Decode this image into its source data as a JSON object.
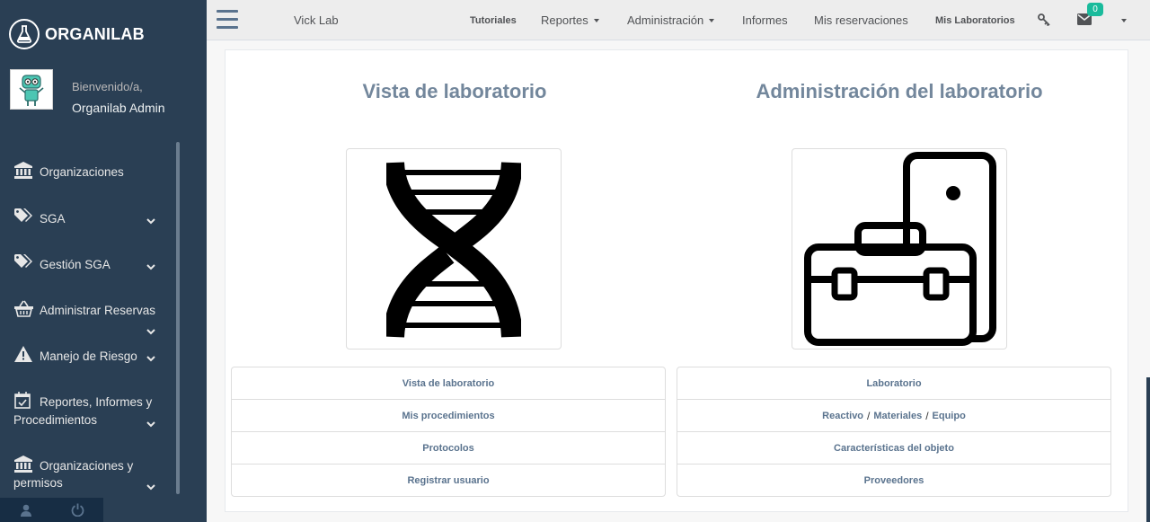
{
  "brand": {
    "name": "ORGANILAB",
    "icon": "flask-icon"
  },
  "profile": {
    "welcome": "Bienvenido/a,",
    "name": "Organilab Admin"
  },
  "sidebar": {
    "items": [
      {
        "label": "Organizaciones",
        "icon": "bank-icon",
        "has_submenu": false
      },
      {
        "label": "SGA",
        "icon": "tags-icon",
        "has_submenu": true
      },
      {
        "label": "Gestión SGA",
        "icon": "tags-icon",
        "has_submenu": true
      },
      {
        "label": "Administrar Reservas",
        "icon": "basket-icon",
        "has_submenu": true
      },
      {
        "label": "Manejo de Riesgo",
        "icon": "warning-icon",
        "has_submenu": true
      },
      {
        "label_line1": "Reportes, Informes y",
        "label_line2": "Procedimientos",
        "icon": "calendar-check-icon",
        "has_submenu": true
      },
      {
        "label_line1": "Organizaciones y",
        "label_line2": "permisos",
        "icon": "bank-icon",
        "has_submenu": true
      }
    ],
    "footer": [
      {
        "icon": "user-icon"
      },
      {
        "icon": "power-icon"
      }
    ]
  },
  "topnav": {
    "lab_name": "Vick Lab",
    "items": [
      {
        "label": "Tutoriales",
        "dropdown": false
      },
      {
        "label": "Reportes",
        "dropdown": true
      },
      {
        "label": "Administración",
        "dropdown": true
      },
      {
        "label": "Informes",
        "dropdown": false
      },
      {
        "label": "Mis reservaciones",
        "dropdown": false
      },
      {
        "label": "Mis Laboratorios",
        "dropdown": false
      }
    ],
    "key_icon": "key-icon",
    "mail_icon": "envelope-icon",
    "mail_count": "0"
  },
  "main": {
    "left": {
      "title": "Vista de laboratorio",
      "image_icon": "dna-icon",
      "links": [
        "Vista de laboratorio",
        "Mis procedimientos",
        "Protocolos",
        "Registrar usuario"
      ]
    },
    "right": {
      "title": "Administración del laboratorio",
      "image_icon": "toolbox-phone-icon",
      "links": {
        "laboratorio": "Laboratorio",
        "reactivo": "Reactivo",
        "materiales": "Materiales",
        "equipo": "Equipo",
        "separator": "/",
        "caracteristicas": "Características del objeto",
        "proveedores": "Proveedores"
      }
    }
  },
  "colors": {
    "sidebar": "#2a3f54",
    "accent": "#1abb9c",
    "title": "#73879c",
    "link": "#5a738e"
  }
}
